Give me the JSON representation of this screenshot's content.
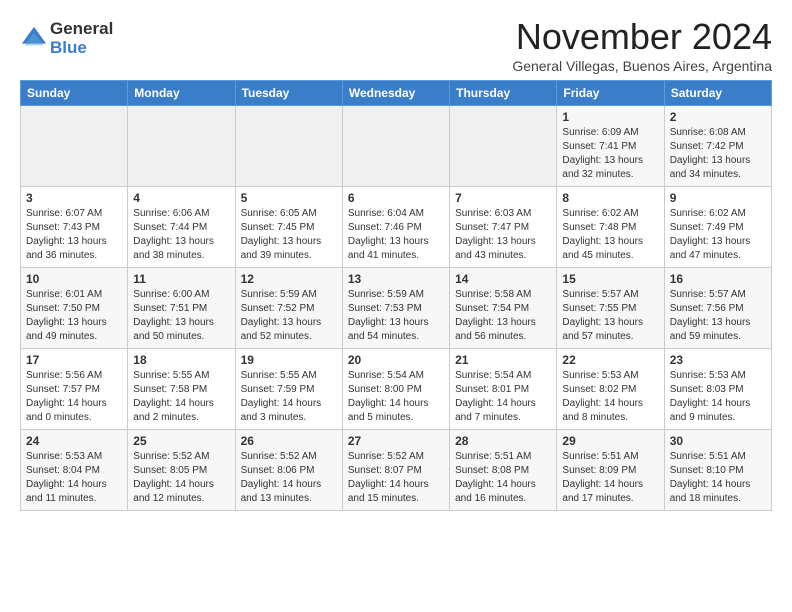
{
  "logo": {
    "general": "General",
    "blue": "Blue"
  },
  "header": {
    "month": "November 2024",
    "location": "General Villegas, Buenos Aires, Argentina"
  },
  "days_of_week": [
    "Sunday",
    "Monday",
    "Tuesday",
    "Wednesday",
    "Thursday",
    "Friday",
    "Saturday"
  ],
  "weeks": [
    [
      {
        "day": "",
        "info": ""
      },
      {
        "day": "",
        "info": ""
      },
      {
        "day": "",
        "info": ""
      },
      {
        "day": "",
        "info": ""
      },
      {
        "day": "",
        "info": ""
      },
      {
        "day": "1",
        "info": "Sunrise: 6:09 AM\nSunset: 7:41 PM\nDaylight: 13 hours\nand 32 minutes."
      },
      {
        "day": "2",
        "info": "Sunrise: 6:08 AM\nSunset: 7:42 PM\nDaylight: 13 hours\nand 34 minutes."
      }
    ],
    [
      {
        "day": "3",
        "info": "Sunrise: 6:07 AM\nSunset: 7:43 PM\nDaylight: 13 hours\nand 36 minutes."
      },
      {
        "day": "4",
        "info": "Sunrise: 6:06 AM\nSunset: 7:44 PM\nDaylight: 13 hours\nand 38 minutes."
      },
      {
        "day": "5",
        "info": "Sunrise: 6:05 AM\nSunset: 7:45 PM\nDaylight: 13 hours\nand 39 minutes."
      },
      {
        "day": "6",
        "info": "Sunrise: 6:04 AM\nSunset: 7:46 PM\nDaylight: 13 hours\nand 41 minutes."
      },
      {
        "day": "7",
        "info": "Sunrise: 6:03 AM\nSunset: 7:47 PM\nDaylight: 13 hours\nand 43 minutes."
      },
      {
        "day": "8",
        "info": "Sunrise: 6:02 AM\nSunset: 7:48 PM\nDaylight: 13 hours\nand 45 minutes."
      },
      {
        "day": "9",
        "info": "Sunrise: 6:02 AM\nSunset: 7:49 PM\nDaylight: 13 hours\nand 47 minutes."
      }
    ],
    [
      {
        "day": "10",
        "info": "Sunrise: 6:01 AM\nSunset: 7:50 PM\nDaylight: 13 hours\nand 49 minutes."
      },
      {
        "day": "11",
        "info": "Sunrise: 6:00 AM\nSunset: 7:51 PM\nDaylight: 13 hours\nand 50 minutes."
      },
      {
        "day": "12",
        "info": "Sunrise: 5:59 AM\nSunset: 7:52 PM\nDaylight: 13 hours\nand 52 minutes."
      },
      {
        "day": "13",
        "info": "Sunrise: 5:59 AM\nSunset: 7:53 PM\nDaylight: 13 hours\nand 54 minutes."
      },
      {
        "day": "14",
        "info": "Sunrise: 5:58 AM\nSunset: 7:54 PM\nDaylight: 13 hours\nand 56 minutes."
      },
      {
        "day": "15",
        "info": "Sunrise: 5:57 AM\nSunset: 7:55 PM\nDaylight: 13 hours\nand 57 minutes."
      },
      {
        "day": "16",
        "info": "Sunrise: 5:57 AM\nSunset: 7:56 PM\nDaylight: 13 hours\nand 59 minutes."
      }
    ],
    [
      {
        "day": "17",
        "info": "Sunrise: 5:56 AM\nSunset: 7:57 PM\nDaylight: 14 hours\nand 0 minutes."
      },
      {
        "day": "18",
        "info": "Sunrise: 5:55 AM\nSunset: 7:58 PM\nDaylight: 14 hours\nand 2 minutes."
      },
      {
        "day": "19",
        "info": "Sunrise: 5:55 AM\nSunset: 7:59 PM\nDaylight: 14 hours\nand 3 minutes."
      },
      {
        "day": "20",
        "info": "Sunrise: 5:54 AM\nSunset: 8:00 PM\nDaylight: 14 hours\nand 5 minutes."
      },
      {
        "day": "21",
        "info": "Sunrise: 5:54 AM\nSunset: 8:01 PM\nDaylight: 14 hours\nand 7 minutes."
      },
      {
        "day": "22",
        "info": "Sunrise: 5:53 AM\nSunset: 8:02 PM\nDaylight: 14 hours\nand 8 minutes."
      },
      {
        "day": "23",
        "info": "Sunrise: 5:53 AM\nSunset: 8:03 PM\nDaylight: 14 hours\nand 9 minutes."
      }
    ],
    [
      {
        "day": "24",
        "info": "Sunrise: 5:53 AM\nSunset: 8:04 PM\nDaylight: 14 hours\nand 11 minutes."
      },
      {
        "day": "25",
        "info": "Sunrise: 5:52 AM\nSunset: 8:05 PM\nDaylight: 14 hours\nand 12 minutes."
      },
      {
        "day": "26",
        "info": "Sunrise: 5:52 AM\nSunset: 8:06 PM\nDaylight: 14 hours\nand 13 minutes."
      },
      {
        "day": "27",
        "info": "Sunrise: 5:52 AM\nSunset: 8:07 PM\nDaylight: 14 hours\nand 15 minutes."
      },
      {
        "day": "28",
        "info": "Sunrise: 5:51 AM\nSunset: 8:08 PM\nDaylight: 14 hours\nand 16 minutes."
      },
      {
        "day": "29",
        "info": "Sunrise: 5:51 AM\nSunset: 8:09 PM\nDaylight: 14 hours\nand 17 minutes."
      },
      {
        "day": "30",
        "info": "Sunrise: 5:51 AM\nSunset: 8:10 PM\nDaylight: 14 hours\nand 18 minutes."
      }
    ]
  ]
}
